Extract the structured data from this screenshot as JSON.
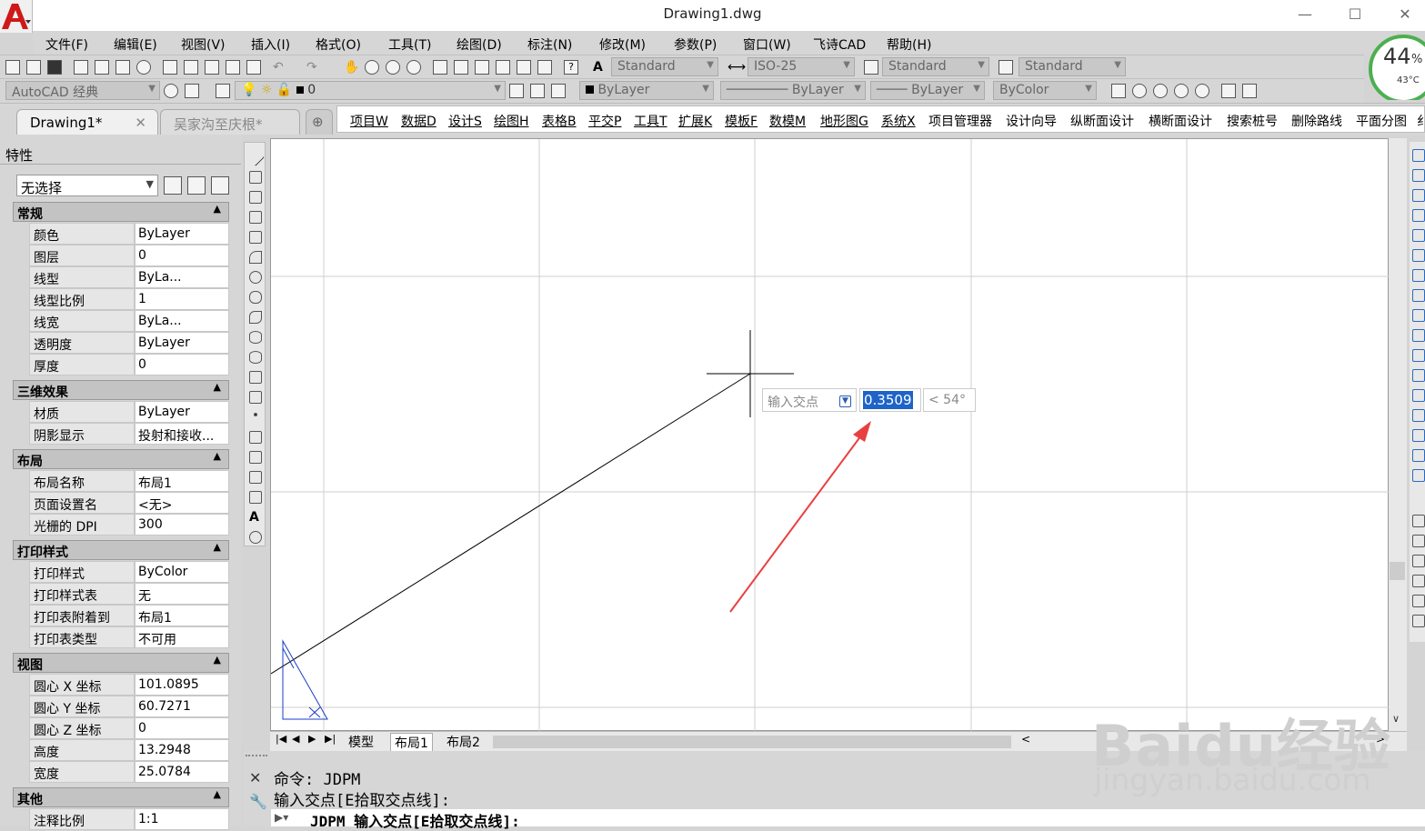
{
  "window": {
    "title": "Drawing1.dwg",
    "minimize": "—",
    "maximize": "☐",
    "close": "✕"
  },
  "menu": [
    "文件(F)",
    "编辑(E)",
    "视图(V)",
    "插入(I)",
    "格式(O)",
    "工具(T)",
    "绘图(D)",
    "标注(N)",
    "修改(M)",
    "参数(P)",
    "窗口(W)",
    "飞诗CAD",
    "帮助(H)"
  ],
  "styles": {
    "text_style": "Standard",
    "dim_style": "ISO-25",
    "table_style": "Standard",
    "mleader_style": "Standard"
  },
  "workspace": "AutoCAD 经典",
  "layer": "0",
  "props_bar": {
    "color": "ByLayer",
    "linetype": "ByLayer",
    "lineweight": "ByLayer",
    "plotstyle": "ByColor"
  },
  "tabs": [
    "Drawing1*",
    "吴家沟至庆根*"
  ],
  "custom_menu": [
    "项目W",
    "数据D",
    "设计S",
    "绘图H",
    "表格B",
    "平交P",
    "工具T",
    "扩展K",
    "模板F",
    "数模M",
    "地形图G",
    "系统X",
    "项目管理器",
    "设计向导",
    "纵断面设计",
    "横断面设计",
    "搜索桩号",
    "删除路线",
    "平面分图",
    "纟"
  ],
  "properties": {
    "title": "特性",
    "selection": "无选择",
    "sections": [
      {
        "name": "常规",
        "rows": [
          [
            "颜色",
            "ByLayer"
          ],
          [
            "图层",
            "0"
          ],
          [
            "线型",
            "ByLa..."
          ],
          [
            "线型比例",
            "1"
          ],
          [
            "线宽",
            "ByLa..."
          ],
          [
            "透明度",
            "ByLayer"
          ],
          [
            "厚度",
            "0"
          ]
        ]
      },
      {
        "name": "三维效果",
        "rows": [
          [
            "材质",
            "ByLayer"
          ],
          [
            "阴影显示",
            "投射和接收..."
          ]
        ]
      },
      {
        "name": "布局",
        "rows": [
          [
            "布局名称",
            "布局1"
          ],
          [
            "页面设置名",
            "<无>"
          ],
          [
            "光栅的 DPI",
            "300"
          ]
        ]
      },
      {
        "name": "打印样式",
        "rows": [
          [
            "打印样式",
            "ByColor"
          ],
          [
            "打印样式表",
            "无"
          ],
          [
            "打印表附着到",
            "布局1"
          ],
          [
            "打印表类型",
            "不可用"
          ]
        ]
      },
      {
        "name": "视图",
        "rows": [
          [
            "圆心 X 坐标",
            "101.0895"
          ],
          [
            "圆心 Y 坐标",
            "60.7271"
          ],
          [
            "圆心 Z 坐标",
            "0"
          ],
          [
            "高度",
            "13.2948"
          ],
          [
            "宽度",
            "25.0784"
          ]
        ]
      },
      {
        "name": "其他",
        "rows": [
          [
            "注释比例",
            "1:1"
          ]
        ]
      }
    ]
  },
  "dynamic_input": {
    "prompt": "输入交点",
    "value": "0.3509",
    "angle": "< 54°"
  },
  "layout_tabs": [
    "模型",
    "布局1",
    "布局2"
  ],
  "command": {
    "line1": "命令: JDPM",
    "line2": "输入交点[E拾取交点线]:",
    "line3": "JDPM 输入交点[E拾取交点线]:"
  },
  "cpu_widget": {
    "percent": "44",
    "unit": "%",
    "temp": "43°C"
  },
  "watermark": {
    "brand": "Baidu经验",
    "url": "jingyan.baidu.com"
  },
  "colors": {
    "accent_red": "#e03a3a",
    "selection_blue": "#1e64c8",
    "drawing_blue": "#1a3cc8",
    "arrow": "#e84040"
  }
}
